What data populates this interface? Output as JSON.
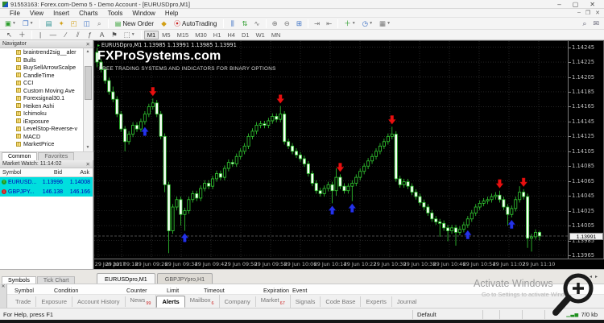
{
  "window": {
    "title": "91553163: Forex.com-Demo 5 - Demo Account - [EURUSDpro,M1]"
  },
  "menu": {
    "items": [
      "File",
      "View",
      "Insert",
      "Charts",
      "Tools",
      "Window",
      "Help"
    ]
  },
  "toolbar": {
    "new_order_label": "New Order",
    "autotrading_label": "AutoTrading",
    "timeframes": [
      "M1",
      "M5",
      "M15",
      "M30",
      "H1",
      "H4",
      "D1",
      "W1",
      "MN"
    ],
    "active_timeframe": "M1",
    "icons": [
      "new-chart",
      "profiles",
      "market-watch-toggle",
      "navigator-toggle",
      "toolbox-toggle",
      "data-window",
      "strategy-tester",
      "bar-chart",
      "candlestick-chart",
      "line-chart",
      "zoom-in",
      "zoom-out",
      "tile-windows",
      "auto-scroll",
      "chart-shift",
      "indicators",
      "periods",
      "templates",
      "search",
      "feedback"
    ]
  },
  "drawbar": {
    "tools": [
      "cursor",
      "crosshair",
      "vertical-line",
      "horizontal-line",
      "trendline",
      "channel",
      "fibonacci",
      "text",
      "label",
      "shapes"
    ]
  },
  "navigator": {
    "title": "Navigator",
    "items": [
      "braintrend2sig__aler",
      "Bulls",
      "BuySellArrowScalpe",
      "CandleTime",
      "CCI",
      "Custom Moving Ave",
      "Forexsignal30.1",
      "Heiken Ashi",
      "Ichimoku",
      "iExposure",
      "LevelStop-Reverse-v",
      "MACD",
      "MarketPrice"
    ],
    "tabs": [
      "Common",
      "Favorites"
    ],
    "active_tab": "Common"
  },
  "market_watch": {
    "title": "Market Watch: 11:14:02",
    "columns": [
      "Symbol",
      "Bid",
      "Ask"
    ],
    "rows": [
      {
        "symbol": "EURUSD...",
        "bid": "1.13996",
        "ask": "1.14008",
        "dir": "up"
      },
      {
        "symbol": "GBPJPY...",
        "bid": "146.138",
        "ask": "146.166",
        "dir": "down"
      }
    ],
    "tabs": [
      "Symbols",
      "Tick Chart"
    ],
    "active_tab": "Symbols"
  },
  "chart": {
    "ohlc_header": "EURUSDpro,M1  1.13985 1.13991 1.13985 1.13991",
    "watermark_title": "FXProSystems.com",
    "watermark_subtitle": "FREE TRADING SYSTEMS AND INDICATORS FOR BINARY OPTIONS",
    "tabs": [
      "EURUSDpro,M1",
      "GBPJPYpro,H1"
    ],
    "active_tab": "EURUSDpro,M1"
  },
  "chart_data": {
    "type": "candlestick",
    "symbol": "EURUSDpro",
    "timeframe": "M1",
    "current_price": 1.13991,
    "y_axis": {
      "max": 1.14245,
      "min": 1.13965,
      "step": 0.0002,
      "labels": [
        "1.14245",
        "1.14225",
        "1.14205",
        "1.14185",
        "1.14165",
        "1.14145",
        "1.14125",
        "1.14105",
        "1.14085",
        "1.14065",
        "1.14045",
        "1.14025",
        "1.14005",
        "1.13985",
        "1.13965"
      ]
    },
    "x_axis": {
      "labels": [
        "29 Jun 2017",
        "29 Jun 09:18",
        "29 Jun 09:26",
        "29 Jun 09:34",
        "29 Jun 09:42",
        "29 Jun 09:50",
        "29 Jun 09:58",
        "29 Jun 10:06",
        "29 Jun 10:14",
        "29 Jun 10:22",
        "29 Jun 10:30",
        "29 Jun 10:38",
        "29 Jun 10:46",
        "29 Jun 10:54",
        "29 Jun 11:02",
        "29 Jun 11:10"
      ]
    },
    "colors": {
      "background": "#000000",
      "grid": "#3c3c3c",
      "bull": "#32CD32",
      "bear_fill": "#ffffff",
      "signal_up": "#2433e8",
      "signal_down": "#e81010",
      "row_highlight": "#00dede"
    },
    "candles": [
      [
        1.14238,
        1.14244,
        1.14218,
        1.14225
      ],
      [
        1.14225,
        1.14229,
        1.14211,
        1.14215
      ],
      [
        1.14215,
        1.14219,
        1.14196,
        1.142
      ],
      [
        1.142,
        1.14204,
        1.14181,
        1.14185
      ],
      [
        1.14185,
        1.14192,
        1.14171,
        1.14175
      ],
      [
        1.14175,
        1.14179,
        1.14151,
        1.14155
      ],
      [
        1.14155,
        1.14159,
        1.14131,
        1.14135
      ],
      [
        1.14135,
        1.14139,
        1.14105,
        1.14118
      ],
      [
        1.14118,
        1.14132,
        1.14114,
        1.14128
      ],
      [
        1.14128,
        1.14144,
        1.14124,
        1.1414
      ],
      [
        1.1414,
        1.14144,
        1.14131,
        1.14135
      ],
      [
        1.14135,
        1.14149,
        1.14131,
        1.14145
      ],
      [
        1.14145,
        1.14159,
        1.14141,
        1.14155
      ],
      [
        1.14155,
        1.14169,
        1.14151,
        1.14165
      ],
      [
        1.14165,
        1.14176,
        1.14161,
        1.1417
      ],
      [
        1.1417,
        1.14174,
        1.14151,
        1.14155
      ],
      [
        1.14155,
        1.14159,
        1.14121,
        1.14125
      ],
      [
        1.14125,
        1.14129,
        1.1405,
        1.1406
      ],
      [
        1.1406,
        1.14064,
        1.13968,
        1.13998
      ],
      [
        1.13998,
        1.14034,
        1.13994,
        1.1403
      ],
      [
        1.1403,
        1.14044,
        1.14026,
        1.1404
      ],
      [
        1.1404,
        1.14044,
        1.14005,
        1.1402
      ],
      [
        1.1402,
        1.14029,
        1.13998,
        1.14025
      ],
      [
        1.14025,
        1.14044,
        1.14021,
        1.1404
      ],
      [
        1.1404,
        1.14052,
        1.14036,
        1.14048
      ],
      [
        1.14048,
        1.14052,
        1.14038,
        1.14042
      ],
      [
        1.14042,
        1.14059,
        1.14038,
        1.14055
      ],
      [
        1.14055,
        1.14066,
        1.14051,
        1.14062
      ],
      [
        1.14062,
        1.14066,
        1.14054,
        1.14058
      ],
      [
        1.14058,
        1.14072,
        1.14054,
        1.14068
      ],
      [
        1.14068,
        1.14079,
        1.14064,
        1.14075
      ],
      [
        1.14075,
        1.14079,
        1.14066,
        1.1407
      ],
      [
        1.1407,
        1.14086,
        1.14066,
        1.14082
      ],
      [
        1.14082,
        1.14094,
        1.14078,
        1.1409
      ],
      [
        1.1409,
        1.14094,
        1.14084,
        1.14088
      ],
      [
        1.14088,
        1.14102,
        1.14084,
        1.14098
      ],
      [
        1.14098,
        1.14109,
        1.14094,
        1.14105
      ],
      [
        1.14105,
        1.14116,
        1.14101,
        1.14112
      ],
      [
        1.14112,
        1.14129,
        1.14108,
        1.14125
      ],
      [
        1.14125,
        1.14136,
        1.14121,
        1.14132
      ],
      [
        1.14132,
        1.14144,
        1.14128,
        1.1414
      ],
      [
        1.1414,
        1.14146,
        1.14136,
        1.14142
      ],
      [
        1.14142,
        1.14146,
        1.14136,
        1.1414
      ],
      [
        1.1414,
        1.1415,
        1.14136,
        1.14146
      ],
      [
        1.14146,
        1.14156,
        1.14142,
        1.14152
      ],
      [
        1.14152,
        1.14156,
        1.14144,
        1.14148
      ],
      [
        1.14148,
        1.14166,
        1.14144,
        1.14155
      ],
      [
        1.14155,
        1.14159,
        1.14114,
        1.14118
      ],
      [
        1.14118,
        1.14122,
        1.14108,
        1.14112
      ],
      [
        1.14112,
        1.14116,
        1.14101,
        1.14105
      ],
      [
        1.14105,
        1.14109,
        1.14096,
        1.141
      ],
      [
        1.141,
        1.14104,
        1.14091,
        1.14095
      ],
      [
        1.14095,
        1.14099,
        1.14084,
        1.14088
      ],
      [
        1.14088,
        1.14092,
        1.14071,
        1.14075
      ],
      [
        1.14075,
        1.14079,
        1.14058,
        1.14062
      ],
      [
        1.14062,
        1.14066,
        1.14048,
        1.14052
      ],
      [
        1.14052,
        1.14056,
        1.14044,
        1.14048
      ],
      [
        1.14048,
        1.14059,
        1.14044,
        1.14055
      ],
      [
        1.14055,
        1.14064,
        1.14051,
        1.1406
      ],
      [
        1.1406,
        1.14064,
        1.14035,
        1.14052
      ],
      [
        1.14052,
        1.14082,
        1.14045,
        1.1407
      ],
      [
        1.1407,
        1.14074,
        1.14054,
        1.14058
      ],
      [
        1.14058,
        1.14062,
        1.14048,
        1.14052
      ],
      [
        1.14052,
        1.14062,
        1.14048,
        1.14058
      ],
      [
        1.14058,
        1.14066,
        1.14038,
        1.14062
      ],
      [
        1.14062,
        1.14074,
        1.14058,
        1.1407
      ],
      [
        1.1407,
        1.14082,
        1.14066,
        1.14078
      ],
      [
        1.14078,
        1.14089,
        1.14074,
        1.14085
      ],
      [
        1.14085,
        1.14096,
        1.14081,
        1.14092
      ],
      [
        1.14092,
        1.14102,
        1.14088,
        1.14098
      ],
      [
        1.14098,
        1.14109,
        1.14094,
        1.14105
      ],
      [
        1.14105,
        1.14116,
        1.14101,
        1.14112
      ],
      [
        1.14112,
        1.14122,
        1.14108,
        1.14118
      ],
      [
        1.14118,
        1.14129,
        1.14114,
        1.14125
      ],
      [
        1.14125,
        1.14138,
        1.14121,
        1.14128
      ],
      [
        1.14128,
        1.14132,
        1.14064,
        1.14068
      ],
      [
        1.14068,
        1.14072,
        1.14056,
        1.1406
      ],
      [
        1.1406,
        1.14068,
        1.14056,
        1.14064
      ],
      [
        1.14064,
        1.14068,
        1.14054,
        1.14058
      ],
      [
        1.14058,
        1.14062,
        1.14046,
        1.1405
      ],
      [
        1.1405,
        1.14054,
        1.1404,
        1.14044
      ],
      [
        1.14044,
        1.14048,
        1.14032,
        1.14036
      ],
      [
        1.14036,
        1.1404,
        1.14026,
        1.1403
      ],
      [
        1.1403,
        1.14034,
        1.14018,
        1.14022
      ],
      [
        1.14022,
        1.14026,
        1.1401,
        1.14014
      ],
      [
        1.14014,
        1.14018,
        1.14006,
        1.1401
      ],
      [
        1.1401,
        1.14014,
        1.1399,
        1.14008
      ],
      [
        1.14008,
        1.14012,
        1.13998,
        1.14002
      ],
      [
        1.14002,
        1.14006,
        1.13984,
        1.13998
      ],
      [
        1.13998,
        1.14006,
        1.13994,
        1.14002
      ],
      [
        1.14002,
        1.14006,
        1.13978,
        1.13996
      ],
      [
        1.13996,
        1.14004,
        1.13992,
        1.14
      ],
      [
        1.14,
        1.1401,
        1.13996,
        1.14006
      ],
      [
        1.14006,
        1.14018,
        1.14002,
        1.14014
      ],
      [
        1.14014,
        1.14026,
        1.1401,
        1.14022
      ],
      [
        1.14022,
        1.14034,
        1.14018,
        1.1403
      ],
      [
        1.1403,
        1.14039,
        1.14026,
        1.14035
      ],
      [
        1.14035,
        1.14042,
        1.14031,
        1.14038
      ],
      [
        1.14038,
        1.14044,
        1.14034,
        1.1404
      ],
      [
        1.1404,
        1.14048,
        1.14036,
        1.14044
      ],
      [
        1.14044,
        1.1405,
        1.1404,
        1.14046
      ],
      [
        1.14046,
        1.14052,
        1.14036,
        1.1404
      ],
      [
        1.1404,
        1.14044,
        1.14026,
        1.1403
      ],
      [
        1.1403,
        1.14034,
        1.14005,
        1.1402
      ],
      [
        1.1402,
        1.14032,
        1.14016,
        1.14028
      ],
      [
        1.14028,
        1.14044,
        1.14024,
        1.1404
      ],
      [
        1.1404,
        1.14058,
        1.14036,
        1.1405
      ],
      [
        1.1405,
        1.14054,
        1.1404,
        1.14044
      ],
      [
        1.14044,
        1.14048,
        1.13975,
        1.13988
      ],
      [
        1.13988,
        1.13994,
        1.1397,
        1.1399
      ],
      [
        1.1399,
        1.14,
        1.13986,
        1.13996
      ],
      [
        1.13996,
        1.13998,
        1.13985,
        1.13991
      ]
    ],
    "signals": [
      {
        "bar": 12,
        "dir": "up"
      },
      {
        "bar": 14,
        "dir": "down"
      },
      {
        "bar": 22,
        "dir": "up"
      },
      {
        "bar": 46,
        "dir": "down"
      },
      {
        "bar": 59,
        "dir": "up"
      },
      {
        "bar": 61,
        "dir": "down"
      },
      {
        "bar": 64,
        "dir": "up"
      },
      {
        "bar": 74,
        "dir": "down"
      },
      {
        "bar": 93,
        "dir": "up"
      },
      {
        "bar": 101,
        "dir": "down"
      },
      {
        "bar": 104,
        "dir": "up"
      },
      {
        "bar": 107,
        "dir": "down"
      }
    ]
  },
  "toolbox": {
    "columns": [
      "Symbol",
      "Condition",
      "Counter",
      "Limit",
      "Timeout",
      "Expiration",
      "Event"
    ],
    "tabs": [
      {
        "label": "Trade"
      },
      {
        "label": "Exposure"
      },
      {
        "label": "Account History"
      },
      {
        "label": "News",
        "badge": "99"
      },
      {
        "label": "Alerts",
        "active": true
      },
      {
        "label": "Mailbox",
        "badge": "6"
      },
      {
        "label": "Company"
      },
      {
        "label": "Market",
        "badge": "67"
      },
      {
        "label": "Signals"
      },
      {
        "label": "Code Base"
      },
      {
        "label": "Experts"
      },
      {
        "label": "Journal"
      }
    ]
  },
  "status_bar": {
    "help": "For Help, press F1",
    "profile": "Default",
    "traffic": "7/0 kb"
  },
  "overlay": {
    "activate_line1": "Activate Windows",
    "activate_line2": "Go to Settings to activate Windo"
  }
}
